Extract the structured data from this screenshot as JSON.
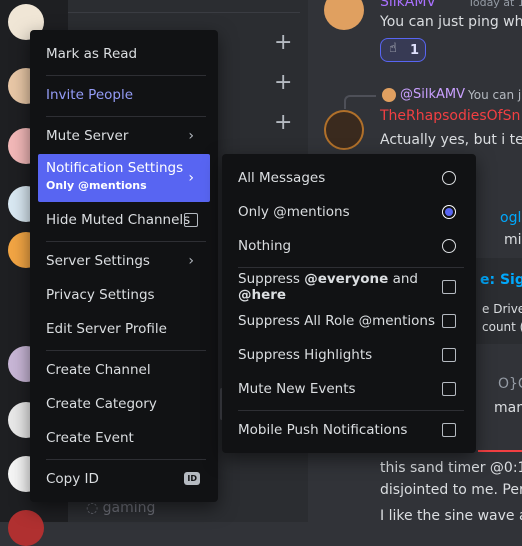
{
  "background_chat": {
    "top_message_author": "SilkAMV",
    "top_message_time": "Today at 1:3",
    "top_message_text": "You can just ping whe",
    "reaction_count": "1",
    "reply_ref_author": "@SilkAMV",
    "reply_ref_text": "You can j",
    "reply_author": "TheRhapsodiesOfSn",
    "reply_text": "Actually yes, but i ter",
    "link_text": "ogle.co",
    "minutes_text": "minutes",
    "embed_title": "e: Sign",
    "embed_line1": "e Drive w",
    "embed_line2": "count (",
    "cpu_text": "O}Cpu",
    "mark_text": "mark @",
    "sand_timer_text": "this sand timer @0:1",
    "disjointed_text": "disjointed to me. Perl",
    "sine_text": "I like the sine wave at",
    "channel_gaming": "gaming"
  },
  "context_menu": {
    "items": [
      {
        "label": "Mark as Read"
      },
      {
        "label": "Invite People"
      },
      {
        "label": "Mute Server"
      },
      {
        "label": "Notification Settings",
        "sub": "Only @mentions"
      },
      {
        "label": "Hide Muted Channels"
      },
      {
        "label": "Server Settings"
      },
      {
        "label": "Privacy Settings"
      },
      {
        "label": "Edit Server Profile"
      },
      {
        "label": "Create Channel"
      },
      {
        "label": "Create Category"
      },
      {
        "label": "Create Event"
      },
      {
        "label": "Copy ID"
      }
    ],
    "copy_id_badge": "ID"
  },
  "submenu": {
    "options": [
      {
        "label": "All Messages",
        "selected": false
      },
      {
        "label": "Only @mentions",
        "selected": true
      },
      {
        "label": "Nothing",
        "selected": false
      }
    ],
    "checks": [
      {
        "prefix": "Suppress ",
        "bold": "@everyone",
        "mid": " and ",
        "bold2": "@here"
      },
      {
        "label": "Suppress All Role @mentions"
      },
      {
        "label": "Suppress Highlights"
      },
      {
        "label": "Mute New Events"
      },
      {
        "label": "Mobile Push Notifications"
      }
    ]
  },
  "colors": {
    "accent": "#5865f2",
    "invite": "#949cf7",
    "username_red": "#f23f42",
    "username_purple": "#a970ff",
    "link": "#00a8fc"
  }
}
